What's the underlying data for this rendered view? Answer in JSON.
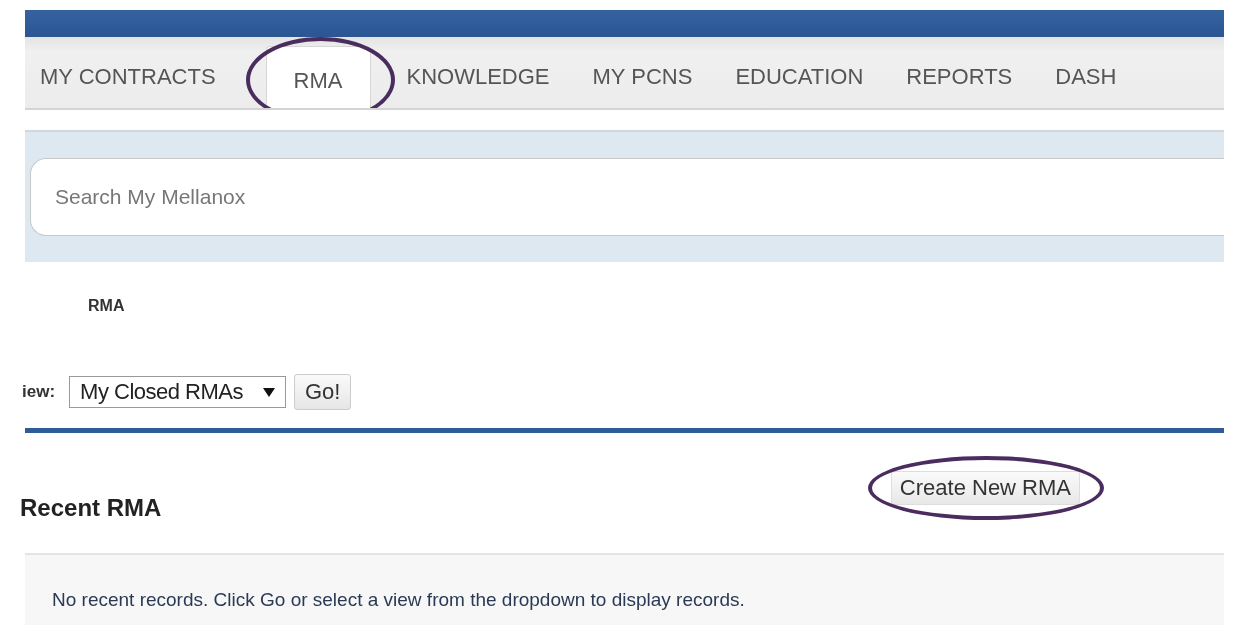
{
  "tabs": [
    {
      "label": "MY CONTRACTS",
      "selected": false,
      "highlighted": false
    },
    {
      "label": "RMA",
      "selected": true,
      "highlighted": true
    },
    {
      "label": "KNOWLEDGE",
      "selected": false,
      "highlighted": false
    },
    {
      "label": "MY PCNS",
      "selected": false,
      "highlighted": false
    },
    {
      "label": "EDUCATION",
      "selected": false,
      "highlighted": false
    },
    {
      "label": "REPORTS",
      "selected": false,
      "highlighted": false
    },
    {
      "label": "DASH",
      "selected": false,
      "highlighted": false
    }
  ],
  "search": {
    "placeholder": "Search My Mellanox"
  },
  "breadcrumb": "RMA",
  "view_filter": {
    "label": "iew:",
    "value": "My Closed RMAs",
    "button": "Go!"
  },
  "recent": {
    "title": "Recent RMA",
    "button": {
      "label": "Create New RMA",
      "highlighted": true
    },
    "message": "No recent records. Click Go or select a view from the dropdown to display records."
  }
}
